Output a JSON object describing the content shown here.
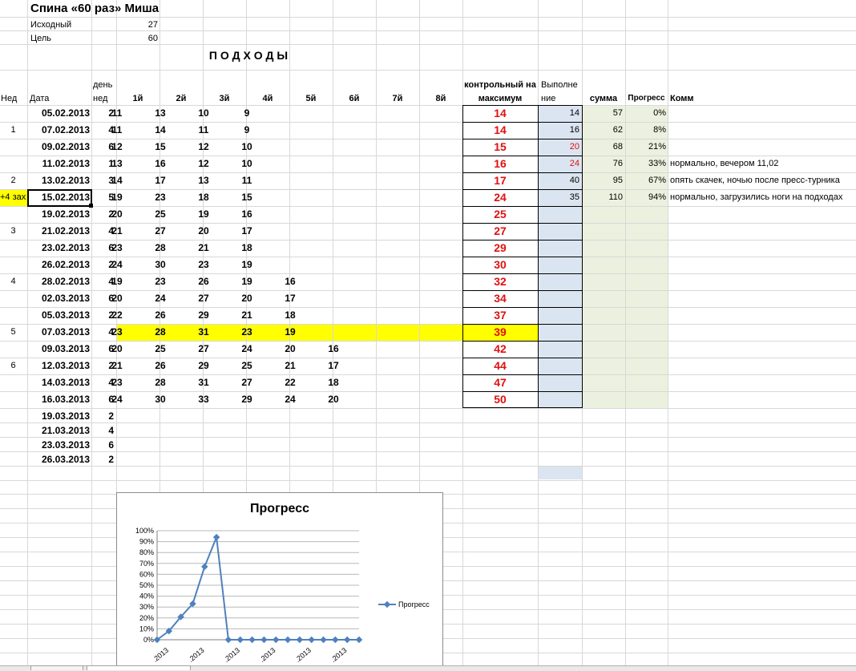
{
  "sheet": {
    "title": "Спина «60 раз» Миша",
    "initial_label": "Исходный",
    "initial_value": "27",
    "goal_label": "Цель",
    "goal_value": "60",
    "section_title": "П О Д Х О Д Ы"
  },
  "headers": {
    "ned": "Нед",
    "date": "Дата",
    "day_week_1": "день",
    "day_week_2": "нед",
    "sets": [
      "1й",
      "2й",
      "3й",
      "4й",
      "5й",
      "6й",
      "7й",
      "8й"
    ],
    "control_1": "контрольный на",
    "control_2": "максимум",
    "done_1": "Выполне",
    "done_2": "ние",
    "sum": "сумма",
    "progress": "Прогресс",
    "comment": "Комментарий"
  },
  "rows": [
    {
      "ned": "",
      "date": "05.02.2013",
      "day": "2",
      "sets": [
        "11",
        "13",
        "10",
        "9",
        "",
        ""
      ],
      "control": "14",
      "done": "14",
      "done_red": false,
      "sum": "57",
      "progress": "0%",
      "comment": ""
    },
    {
      "ned": "1",
      "date": "07.02.2013",
      "day": "4",
      "sets": [
        "11",
        "14",
        "11",
        "9",
        "",
        ""
      ],
      "control": "14",
      "done": "16",
      "done_red": false,
      "sum": "62",
      "progress": "8%",
      "comment": ""
    },
    {
      "ned": "",
      "date": "09.02.2013",
      "day": "6",
      "sets": [
        "12",
        "15",
        "12",
        "10",
        "",
        ""
      ],
      "control": "15",
      "done": "20",
      "done_red": true,
      "sum": "68",
      "progress": "21%",
      "comment": ""
    },
    {
      "ned": "",
      "date": "11.02.2013",
      "day": "1",
      "sets": [
        "13",
        "16",
        "12",
        "10",
        "",
        ""
      ],
      "control": "16",
      "done": "24",
      "done_red": true,
      "sum": "76",
      "progress": "33%",
      "comment": "нормально, вечером 11,02"
    },
    {
      "ned": "2",
      "date": "13.02.2013",
      "day": "3",
      "sets": [
        "14",
        "17",
        "13",
        "11",
        "",
        ""
      ],
      "control": "17",
      "done": "40",
      "done_red": false,
      "sum": "95",
      "progress": "67%",
      "comment": "опять скачек, ночью после пресс-турника"
    },
    {
      "ned": "+4 зах",
      "date": "15.02.2013",
      "day": "5",
      "sets": [
        "19",
        "23",
        "18",
        "15",
        "",
        ""
      ],
      "control": "24",
      "done": "35",
      "done_red": false,
      "sum": "110",
      "progress": "94%",
      "comment": "нормально, загрузились ноги на подходах"
    },
    {
      "ned": "",
      "date": "19.02.2013",
      "day": "2",
      "sets": [
        "20",
        "25",
        "19",
        "16",
        "",
        ""
      ],
      "control": "25",
      "done": "",
      "done_red": false,
      "sum": "",
      "progress": "",
      "comment": ""
    },
    {
      "ned": "3",
      "date": "21.02.2013",
      "day": "4",
      "sets": [
        "21",
        "27",
        "20",
        "17",
        "",
        ""
      ],
      "control": "27",
      "done": "",
      "done_red": false,
      "sum": "",
      "progress": "",
      "comment": ""
    },
    {
      "ned": "",
      "date": "23.02.2013",
      "day": "6",
      "sets": [
        "23",
        "28",
        "21",
        "18",
        "",
        ""
      ],
      "control": "29",
      "done": "",
      "done_red": false,
      "sum": "",
      "progress": "",
      "comment": ""
    },
    {
      "ned": "",
      "date": "26.02.2013",
      "day": "2",
      "sets": [
        "24",
        "30",
        "23",
        "19",
        "",
        ""
      ],
      "control": "30",
      "done": "",
      "done_red": false,
      "sum": "",
      "progress": "",
      "comment": ""
    },
    {
      "ned": "4",
      "date": "28.02.2013",
      "day": "4",
      "sets": [
        "19",
        "23",
        "26",
        "19",
        "16",
        ""
      ],
      "control": "32",
      "done": "",
      "done_red": false,
      "sum": "",
      "progress": "",
      "comment": ""
    },
    {
      "ned": "",
      "date": "02.03.2013",
      "day": "6",
      "sets": [
        "20",
        "24",
        "27",
        "20",
        "17",
        ""
      ],
      "control": "34",
      "done": "",
      "done_red": false,
      "sum": "",
      "progress": "",
      "comment": ""
    },
    {
      "ned": "",
      "date": "05.03.2013",
      "day": "2",
      "sets": [
        "22",
        "26",
        "29",
        "21",
        "18",
        ""
      ],
      "control": "37",
      "done": "",
      "done_red": false,
      "sum": "",
      "progress": "",
      "comment": ""
    },
    {
      "ned": "5",
      "date": "07.03.2013",
      "day": "4",
      "sets": [
        "23",
        "28",
        "31",
        "23",
        "19",
        ""
      ],
      "control": "39",
      "done": "",
      "done_red": false,
      "sum": "",
      "progress": "",
      "comment": ""
    },
    {
      "ned": "",
      "date": "09.03.2013",
      "day": "6",
      "sets": [
        "20",
        "25",
        "27",
        "24",
        "20",
        "16"
      ],
      "control": "42",
      "done": "",
      "done_red": false,
      "sum": "",
      "progress": "",
      "comment": ""
    },
    {
      "ned": "6",
      "date": "12.03.2013",
      "day": "2",
      "sets": [
        "21",
        "26",
        "29",
        "25",
        "21",
        "17"
      ],
      "control": "44",
      "done": "",
      "done_red": false,
      "sum": "",
      "progress": "",
      "comment": ""
    },
    {
      "ned": "",
      "date": "14.03.2013",
      "day": "4",
      "sets": [
        "23",
        "28",
        "31",
        "27",
        "22",
        "18"
      ],
      "control": "47",
      "done": "",
      "done_red": false,
      "sum": "",
      "progress": "",
      "comment": ""
    },
    {
      "ned": "",
      "date": "16.03.2013",
      "day": "6",
      "sets": [
        "24",
        "30",
        "33",
        "29",
        "24",
        "20"
      ],
      "control": "50",
      "done": "",
      "done_red": false,
      "sum": "",
      "progress": "",
      "comment": ""
    }
  ],
  "extra_rows": [
    {
      "date": "19.03.2013",
      "day": "2"
    },
    {
      "date": "21.03.2013",
      "day": "4"
    },
    {
      "date": "23.03.2013",
      "day": "6"
    },
    {
      "date": "26.03.2013",
      "day": "2"
    }
  ],
  "highlight_color": "#ffff00",
  "done_fill": "#dbe5f1",
  "sum_fill": "#ebf1de",
  "chart_data": {
    "type": "line",
    "title": "Прогресс",
    "series": [
      {
        "name": "Прогресс",
        "values": [
          0,
          0.08,
          0.21,
          0.33,
          0.67,
          0.94,
          0,
          0,
          0,
          0,
          0,
          0,
          0,
          0,
          0,
          0,
          0,
          0
        ]
      }
    ],
    "y_ticks": [
      "0%",
      "10%",
      "20%",
      "30%",
      "40%",
      "50%",
      "60%",
      "70%",
      "80%",
      "90%",
      "100%"
    ],
    "ylim": [
      0,
      1
    ],
    "x_tick_labels": [
      ".2013",
      ".2013",
      ".2013",
      ".2013",
      ".2013",
      ".2013"
    ],
    "legend_position": "right",
    "color": "#4f81bd"
  }
}
